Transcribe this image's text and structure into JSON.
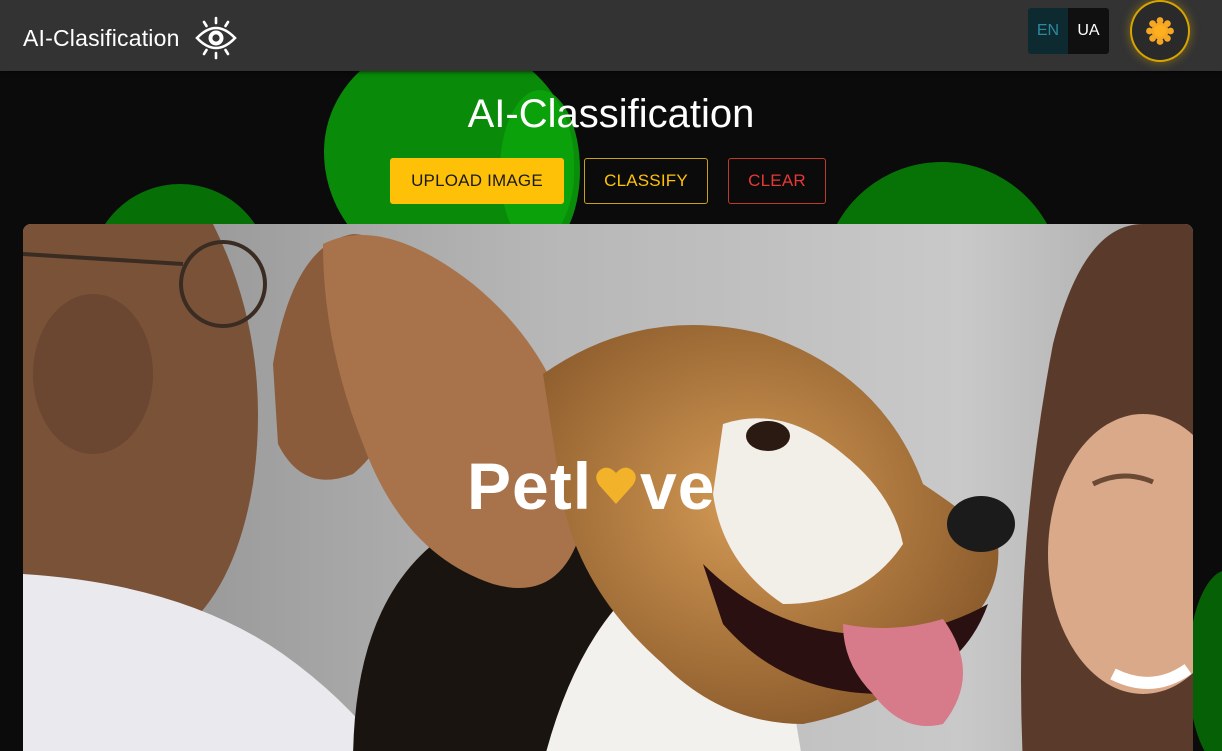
{
  "header": {
    "app_title": "AI-Clasification",
    "logo_icon": "eye-icon",
    "languages": [
      {
        "code": "EN",
        "active": true
      },
      {
        "code": "UA",
        "active": false
      }
    ],
    "theme_toggle_icon": "sun-icon"
  },
  "main": {
    "title": "AI-Classification",
    "actions": {
      "upload_label": "UPLOAD IMAGE",
      "classify_label": "CLASSIFY",
      "clear_label": "CLEAR"
    },
    "image": {
      "subject": "beagle at vet with two people",
      "logo_text_before": "Petl",
      "logo_text_after": "ve",
      "logo_heart_icon": "heart-icon"
    }
  },
  "colors": {
    "header_bg": "#333333",
    "page_bg": "#0b0b0b",
    "accent_yellow": "#ffc107",
    "danger_red": "#e53935",
    "blob_green": "#098a09",
    "heart_gold": "#f2b22a"
  }
}
